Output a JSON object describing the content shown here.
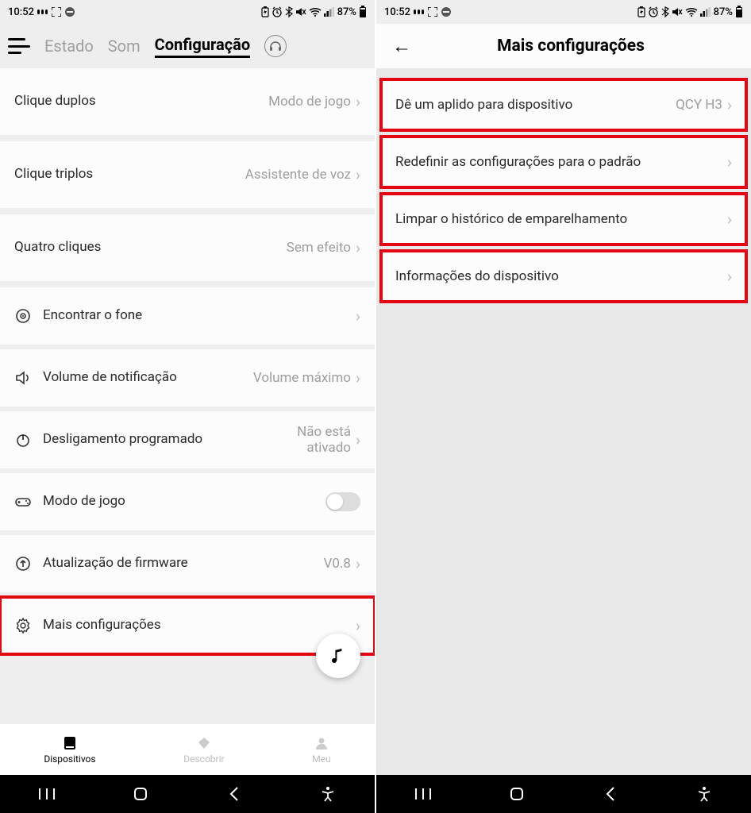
{
  "statusbar": {
    "time": "10:52",
    "battery": "87%"
  },
  "left": {
    "tabs": {
      "status": "Estado",
      "sound": "Som",
      "config": "Configuração"
    },
    "gesture": {
      "double": {
        "label": "Clique duplos",
        "value": "Modo de jogo"
      },
      "triple": {
        "label": "Clique triplos",
        "value": "Assistente de voz"
      },
      "quad": {
        "label": "Quatro cliques",
        "value": "Sem efeito"
      }
    },
    "settings": {
      "find": {
        "label": "Encontrar o fone"
      },
      "vol": {
        "label": "Volume de notificação",
        "value": "Volume máximo"
      },
      "shutdown": {
        "label": "Desligamento programado",
        "value": "Não está ativado"
      },
      "game": {
        "label": "Modo de jogo"
      },
      "fw": {
        "label": "Atualização de firmware",
        "value": "V0.8"
      },
      "more": {
        "label": "Mais configurações"
      }
    },
    "nav": {
      "devices": "Dispositivos",
      "discover": "Descobrir",
      "me": "Meu"
    }
  },
  "right": {
    "title": "Mais configurações",
    "items": {
      "nick": {
        "label": "Dê um aplido para dispositivo",
        "value": "QCY H3"
      },
      "reset": {
        "label": "Redefinir as configurações para o padrão"
      },
      "clear": {
        "label": "Limpar o histórico de emparelhamento"
      },
      "info": {
        "label": "Informações do dispositivo"
      }
    }
  }
}
